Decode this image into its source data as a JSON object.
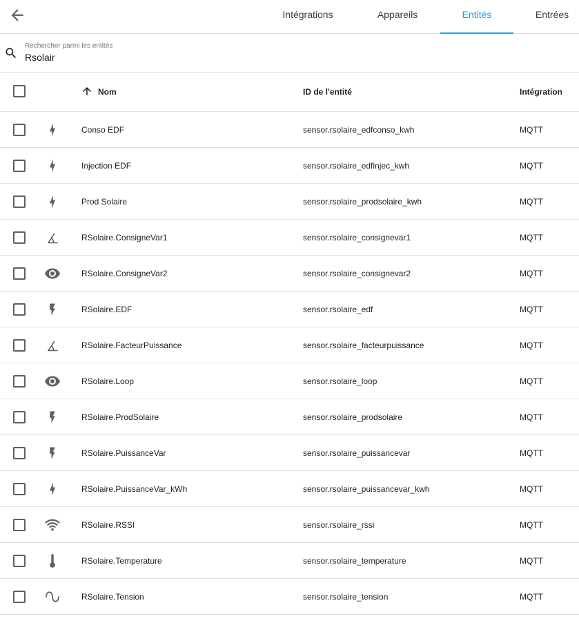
{
  "tabs": [
    {
      "label": "Intégrations",
      "active": false
    },
    {
      "label": "Appareils",
      "active": false
    },
    {
      "label": "Entités",
      "active": true
    },
    {
      "label": "Entrées",
      "active": false
    }
  ],
  "search": {
    "placeholder": "Rechercher parmi les entités",
    "value": "Rsolair"
  },
  "table": {
    "columns": {
      "name": "Nom",
      "entity_id": "ID de l'entité",
      "integration": "Intégration"
    },
    "sort": {
      "column": "name",
      "direction": "ascending"
    },
    "rows": [
      {
        "icon": "flash-icon",
        "name": "Conso EDF",
        "entity_id": "sensor.rsolaire_edfconso_kwh",
        "integration": "MQTT"
      },
      {
        "icon": "flash-icon",
        "name": "Injection EDF",
        "entity_id": "sensor.rsolaire_edfinjec_kwh",
        "integration": "MQTT"
      },
      {
        "icon": "flash-icon",
        "name": "Prod Solaire",
        "entity_id": "sensor.rsolaire_prodsolaire_kwh",
        "integration": "MQTT"
      },
      {
        "icon": "angle-icon",
        "name": "RSolaire.ConsigneVar1",
        "entity_id": "sensor.rsolaire_consignevar1",
        "integration": "MQTT"
      },
      {
        "icon": "eye-icon",
        "name": "RSolaire.ConsigneVar2",
        "entity_id": "sensor.rsolaire_consignevar2",
        "integration": "MQTT"
      },
      {
        "icon": "flash-bold-icon",
        "name": "RSolaire.EDF",
        "entity_id": "sensor.rsolaire_edf",
        "integration": "MQTT"
      },
      {
        "icon": "angle-icon",
        "name": "RSolaire.FacteurPuissance",
        "entity_id": "sensor.rsolaire_facteurpuissance",
        "integration": "MQTT"
      },
      {
        "icon": "eye-icon",
        "name": "RSolaire.Loop",
        "entity_id": "sensor.rsolaire_loop",
        "integration": "MQTT"
      },
      {
        "icon": "flash-bold-icon",
        "name": "RSolaire.ProdSolaire",
        "entity_id": "sensor.rsolaire_prodsolaire",
        "integration": "MQTT"
      },
      {
        "icon": "flash-bold-icon",
        "name": "RSolaire.PuissanceVar",
        "entity_id": "sensor.rsolaire_puissancevar",
        "integration": "MQTT"
      },
      {
        "icon": "flash-icon",
        "name": "RSolaire.PuissanceVar_kWh",
        "entity_id": "sensor.rsolaire_puissancevar_kwh",
        "integration": "MQTT"
      },
      {
        "icon": "wifi-icon",
        "name": "RSolaire.RSSI",
        "entity_id": "sensor.rsolaire_rssi",
        "integration": "MQTT"
      },
      {
        "icon": "thermometer-icon",
        "name": "RSolaire.Temperature",
        "entity_id": "sensor.rsolaire_temperature",
        "integration": "MQTT"
      },
      {
        "icon": "sine-wave-icon",
        "name": "RSolaire.Tension",
        "entity_id": "sensor.rsolaire_tension",
        "integration": "MQTT"
      }
    ]
  },
  "colors": {
    "accent": "#03a9f4",
    "icon": "#616161",
    "divider": "#e0e0e0",
    "text": "#212121"
  }
}
